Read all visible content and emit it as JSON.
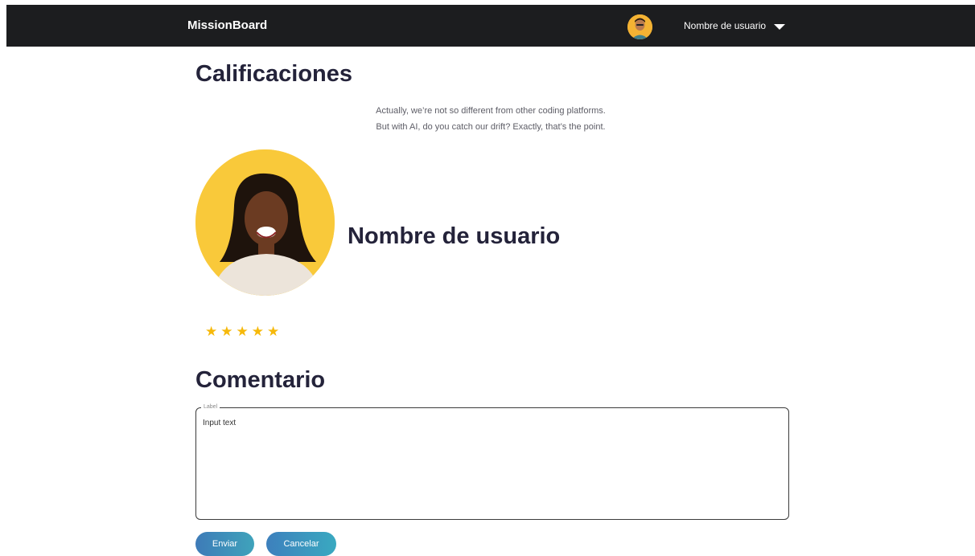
{
  "header": {
    "brand": "MissionBoard",
    "user_name": "Nombre de usuario"
  },
  "page": {
    "title": "Calificaciones",
    "tagline_line1": "Actually, we’re not so different from other coding platforms.",
    "tagline_line2": "But with AI, do you catch our drift? Exactly, that’s the point."
  },
  "profile": {
    "name": "Nombre de usuario"
  },
  "rating": {
    "value": 5,
    "max": 5,
    "star_color": "#f6b90b",
    "star_glyph": "★"
  },
  "comment": {
    "title": "Comentario",
    "label": "Label",
    "value": "Input text"
  },
  "actions": {
    "send_label": "Enviar",
    "cancel_label": "Cancelar"
  },
  "colors": {
    "topbar": "#1c1d1f",
    "heading": "#24233a",
    "button_gradient_start": "#3e7bb8",
    "button_gradient_end": "#3fa3bb"
  }
}
